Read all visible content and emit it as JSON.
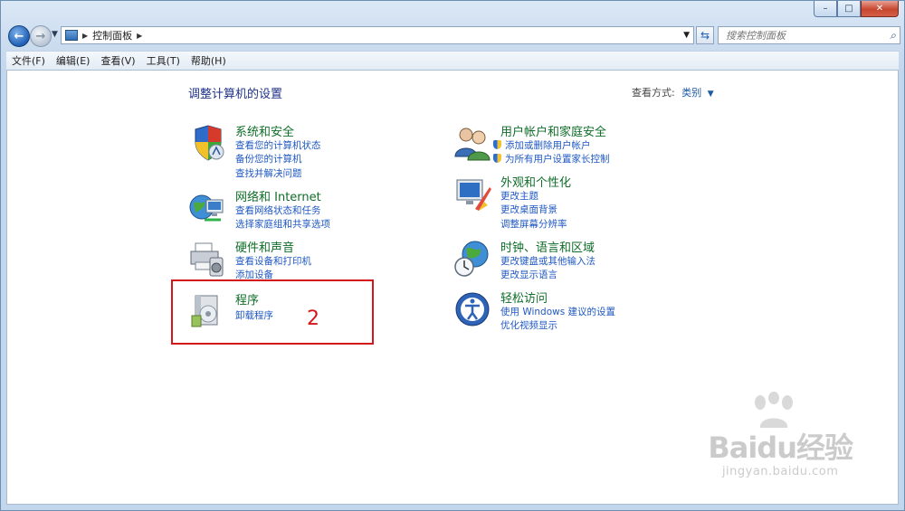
{
  "window": {
    "controls": {
      "minimize": "–",
      "maximize": "□",
      "close": "✕"
    }
  },
  "navbar": {
    "address_path": "控制面板",
    "search_placeholder": "搜索控制面板"
  },
  "menu": [
    "文件(F)",
    "编辑(E)",
    "查看(V)",
    "工具(T)",
    "帮助(H)"
  ],
  "content": {
    "title": "调整计算机的设置",
    "view_by_label": "查看方式:",
    "view_by_value": "类别"
  },
  "categories": {
    "system": {
      "title": "系统和安全",
      "links": [
        "查看您的计算机状态",
        "备份您的计算机",
        "查找并解决问题"
      ]
    },
    "network": {
      "title": "网络和 Internet",
      "links": [
        "查看网络状态和任务",
        "选择家庭组和共享选项"
      ]
    },
    "hardware": {
      "title": "硬件和声音",
      "links": [
        "查看设备和打印机",
        "添加设备"
      ]
    },
    "programs": {
      "title": "程序",
      "links": [
        "卸载程序"
      ]
    },
    "users": {
      "title": "用户帐户和家庭安全",
      "links": [
        "添加或删除用户帐户",
        "为所有用户设置家长控制"
      ]
    },
    "appearance": {
      "title": "外观和个性化",
      "links": [
        "更改主题",
        "更改桌面背景",
        "调整屏幕分辨率"
      ]
    },
    "clock": {
      "title": "时钟、语言和区域",
      "links": [
        "更改键盘或其他输入法",
        "更改显示语言"
      ]
    },
    "ease": {
      "title": "轻松访问",
      "links": [
        "使用 Windows 建议的设置",
        "优化视频显示"
      ]
    }
  },
  "annotation": {
    "number": "2",
    "color": "#d4171a"
  },
  "watermark": {
    "main": "Baidu经验",
    "sub": "jingyan.baidu.com"
  }
}
